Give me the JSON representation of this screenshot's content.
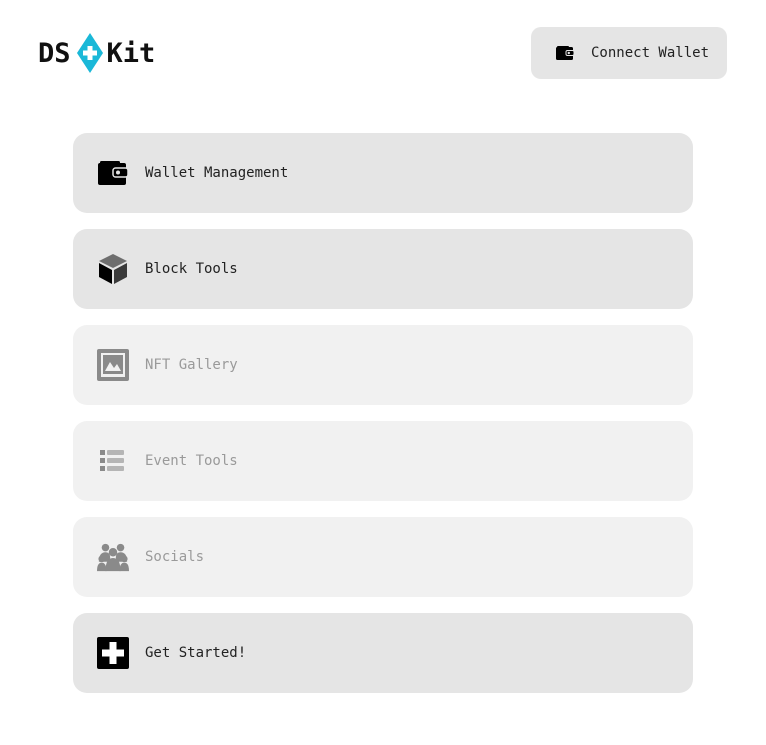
{
  "header": {
    "logo_left": "DS",
    "logo_right": "Kit",
    "logo_accent_color": "#1ab8d8",
    "connect_button": {
      "label": "Connect Wallet",
      "icon": "wallet-icon"
    }
  },
  "menu": {
    "items": [
      {
        "label": "Wallet Management",
        "icon": "wallet-icon",
        "enabled": true
      },
      {
        "label": "Block Tools",
        "icon": "cube-icon",
        "enabled": true
      },
      {
        "label": "NFT Gallery",
        "icon": "image-icon",
        "enabled": false
      },
      {
        "label": "Event Tools",
        "icon": "list-icon",
        "enabled": false
      },
      {
        "label": "Socials",
        "icon": "users-icon",
        "enabled": false
      },
      {
        "label": "Get Started!",
        "icon": "plus-square-icon",
        "enabled": true
      }
    ]
  },
  "colors": {
    "active_bg": "#e5e5e5",
    "disabled_bg": "#f1f1f1",
    "active_text": "#222222",
    "disabled_text": "#9a9a9a",
    "icon_active": "#000000",
    "icon_disabled": "#8a8a8a"
  }
}
